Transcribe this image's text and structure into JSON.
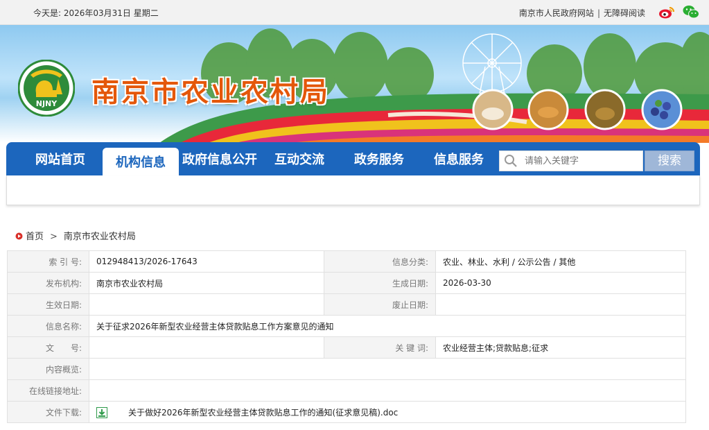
{
  "topbar": {
    "date_text": "今天是: 2026年03月31日 星期二",
    "link_gov": "南京市人民政府网站",
    "separator": "|",
    "link_accessibility": "无障碍阅读",
    "icons": [
      "weibo-icon",
      "wechat-icon"
    ]
  },
  "banner": {
    "site_title": "南京市农业农村局",
    "logo_text": "NJNY"
  },
  "nav": {
    "items": [
      "网站首页",
      "机构信息",
      "政府信息公开",
      "互动交流",
      "政务服务",
      "信息服务"
    ],
    "active_index": 1,
    "search_placeholder": "请输入关键字",
    "search_button": "搜索"
  },
  "breadcrumb": {
    "home": "首页",
    "arrow": ">",
    "current": "南京市农业农村局"
  },
  "meta": {
    "index_label": "索 引 号:",
    "index_value": "012948413/2026-17643",
    "category_label": "信息分类:",
    "category_value": "农业、林业、水利 / 公示公告 / 其他",
    "publisher_label": "发布机构:",
    "publisher_value": "南京市农业农村局",
    "created_label": "生成日期:",
    "created_value": "2026-03-30",
    "effective_label": "生效日期:",
    "effective_value": "",
    "expired_label": "废止日期:",
    "expired_value": "",
    "name_label": "信息名称:",
    "name_value": "关于征求2026年新型农业经营主体贷款贴息工作方案意见的通知",
    "docno_label": "文　　号:",
    "docno_value": "",
    "keywords_label": "关 键 词:",
    "keywords_value": "农业经营主体;贷款贴息;征求",
    "summary_label": "内容概览:",
    "summary_value": "",
    "link_label": "在线链接地址:",
    "link_value": "",
    "download_label": "文件下载:",
    "download_value": "关于做好2026年新型农业经营主体贷款贴息工作的通知(征求意见稿).doc"
  },
  "colors": {
    "nav_blue": "#1c66bd",
    "title_orange": "#e4570a",
    "search_button": "#9fb7d8",
    "label_gray": "#777777"
  }
}
